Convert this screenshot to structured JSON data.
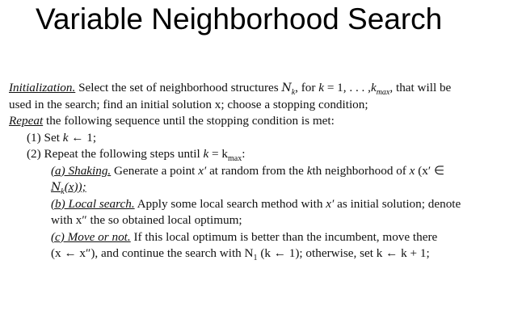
{
  "title": "Variable Neighborhood Search",
  "initialization": {
    "label": "Initialization.",
    "t1": " Select the set of neighborhood structures ",
    "t2": ", for ",
    "t3": " = 1, . . . ,",
    "t4": ", that will be",
    "line2": "used in the search; find an initial solution x; choose a stopping condition;"
  },
  "repeat": {
    "label": "Repeat",
    "text": " the following sequence until the stopping condition is met:"
  },
  "step1": {
    "prefix": "(1) Set ",
    "rest": " ← 1;"
  },
  "step2": {
    "prefix": "(2) Repeat the following steps until ",
    "rest": " = k"
  },
  "shaking": {
    "label": "(a) Shaking.",
    "t1": " Generate a point ",
    "t2": " at random from the ",
    "t3": "th neighborhood of ",
    "t4": " (x′ ∈",
    "line2": "N",
    "line2_rest": "(x));"
  },
  "local_search": {
    "label": "(b) Local search.",
    "t1": " Apply some local search method with ",
    "t2": " as initial solution; denote",
    "line2": "with x″ the so obtained local optimum;"
  },
  "move": {
    "label": "(c) Move or not.",
    "t1": " If this local optimum is better than the incumbent, move there",
    "line2": "(x ← x″), and continue the search with N",
    "line2_mid": " (k ← 1); otherwise, set k ← k + 1;"
  },
  "sym": {
    "N": "N",
    "k": "k",
    "x": "x",
    "x_prime": "x′",
    "kmax_k": "k",
    "max": "max",
    "one": "1"
  }
}
